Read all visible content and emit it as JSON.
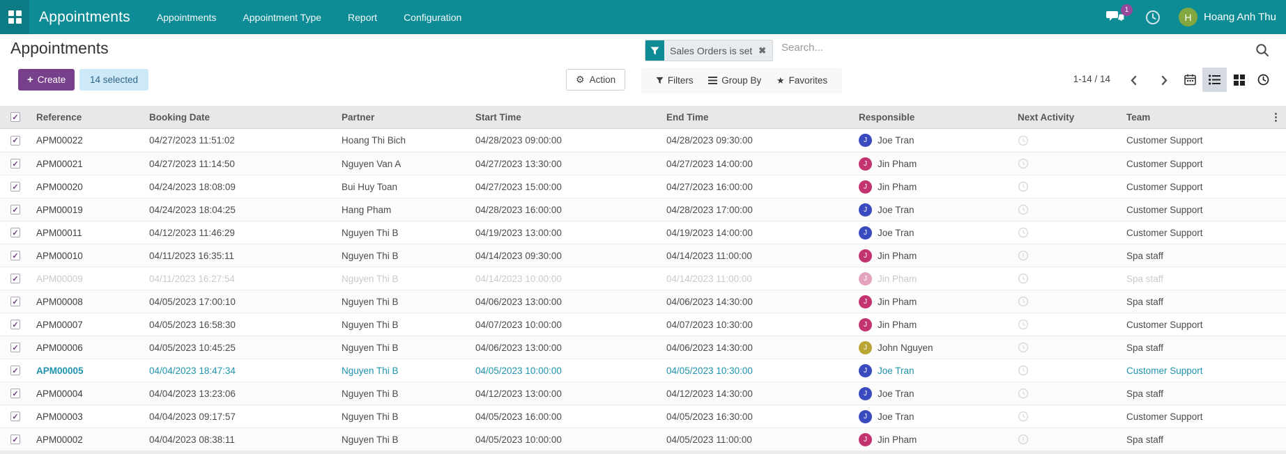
{
  "topbar": {
    "brand": "Appointments",
    "menus": [
      "Appointments",
      "Appointment Type",
      "Report",
      "Configuration"
    ],
    "messages_badge": "1",
    "user": {
      "initial": "H",
      "name": "Hoang Anh Thu"
    }
  },
  "control_panel": {
    "title": "Appointments",
    "create_label": "Create",
    "selected_label": "14 selected",
    "action_label": "Action",
    "filters_label": "Filters",
    "groupby_label": "Group By",
    "favorites_label": "Favorites",
    "pager": "1-14 / 14"
  },
  "search": {
    "facet_label": "Sales Orders is set",
    "placeholder": "Search..."
  },
  "icons": {
    "apps": "grid-2x2",
    "messages": "chat-bubbles",
    "activities": "clock",
    "facet": "funnel",
    "remove_facet": "x",
    "search": "magnifier",
    "action": "gear",
    "filters": "funnel",
    "group_by": "bars",
    "favorites": "star",
    "views": [
      "calendar",
      "list",
      "kanban",
      "activity-clock"
    ],
    "next_activity": "clock-outline",
    "column_options": "kebab-dots"
  },
  "colors": {
    "topbar": "#0e8c96",
    "create": "#76408a",
    "facet_accent": "#0e8c96",
    "highlight": "#1e93ae",
    "muted": "#c9c9c9"
  },
  "table": {
    "headers": [
      "Reference",
      "Booking Date",
      "Partner",
      "Start Time",
      "End Time",
      "Responsible",
      "Next Activity",
      "Team"
    ],
    "rows": [
      {
        "reference": "APM00022",
        "booking_date": "04/27/2023 11:51:02",
        "partner": "Hoang Thi Bich",
        "start_time": "04/28/2023 09:00:00",
        "end_time": "04/28/2023 09:30:00",
        "responsible": "Joe Tran",
        "avatar_initial": "J",
        "avatar_color": "#3a4bbf",
        "team": "Customer Support",
        "state": "normal"
      },
      {
        "reference": "APM00021",
        "booking_date": "04/27/2023 11:14:50",
        "partner": "Nguyen Van A",
        "start_time": "04/27/2023 13:30:00",
        "end_time": "04/27/2023 14:00:00",
        "responsible": "Jin Pham",
        "avatar_initial": "J",
        "avatar_color": "#c2336f",
        "team": "Customer Support",
        "state": "normal"
      },
      {
        "reference": "APM00020",
        "booking_date": "04/24/2023 18:08:09",
        "partner": "Bui Huy Toan",
        "start_time": "04/27/2023 15:00:00",
        "end_time": "04/27/2023 16:00:00",
        "responsible": "Jin Pham",
        "avatar_initial": "J",
        "avatar_color": "#c2336f",
        "team": "Customer Support",
        "state": "normal"
      },
      {
        "reference": "APM00019",
        "booking_date": "04/24/2023 18:04:25",
        "partner": "Hang Pham",
        "start_time": "04/28/2023 16:00:00",
        "end_time": "04/28/2023 17:00:00",
        "responsible": "Joe Tran",
        "avatar_initial": "J",
        "avatar_color": "#3a4bbf",
        "team": "Customer Support",
        "state": "normal"
      },
      {
        "reference": "APM00011",
        "booking_date": "04/12/2023 11:46:29",
        "partner": "Nguyen Thi B",
        "start_time": "04/19/2023 13:00:00",
        "end_time": "04/19/2023 14:00:00",
        "responsible": "Joe Tran",
        "avatar_initial": "J",
        "avatar_color": "#3a4bbf",
        "team": "Customer Support",
        "state": "normal"
      },
      {
        "reference": "APM00010",
        "booking_date": "04/11/2023 16:35:11",
        "partner": "Nguyen Thi B",
        "start_time": "04/14/2023 09:30:00",
        "end_time": "04/14/2023 11:00:00",
        "responsible": "Jin Pham",
        "avatar_initial": "J",
        "avatar_color": "#c2336f",
        "team": "Spa staff",
        "state": "normal"
      },
      {
        "reference": "APM00009",
        "booking_date": "04/11/2023 16:27:54",
        "partner": "Nguyen Thi B",
        "start_time": "04/14/2023 10:00:00",
        "end_time": "04/14/2023 11:00:00",
        "responsible": "Jin Pham",
        "avatar_initial": "J",
        "avatar_color": "#c2336f",
        "team": "Spa staff",
        "state": "muted"
      },
      {
        "reference": "APM00008",
        "booking_date": "04/05/2023 17:00:10",
        "partner": "Nguyen Thi B",
        "start_time": "04/06/2023 13:00:00",
        "end_time": "04/06/2023 14:30:00",
        "responsible": "Jin Pham",
        "avatar_initial": "J",
        "avatar_color": "#c2336f",
        "team": "Spa staff",
        "state": "normal"
      },
      {
        "reference": "APM00007",
        "booking_date": "04/05/2023 16:58:30",
        "partner": "Nguyen Thi B",
        "start_time": "04/07/2023 10:00:00",
        "end_time": "04/07/2023 10:30:00",
        "responsible": "Jin Pham",
        "avatar_initial": "J",
        "avatar_color": "#c2336f",
        "team": "Customer Support",
        "state": "normal"
      },
      {
        "reference": "APM00006",
        "booking_date": "04/05/2023 10:45:25",
        "partner": "Nguyen Thi B",
        "start_time": "04/06/2023 13:00:00",
        "end_time": "04/06/2023 14:30:00",
        "responsible": "John Nguyen",
        "avatar_initial": "J",
        "avatar_color": "#b8a533",
        "team": "Spa staff",
        "state": "normal"
      },
      {
        "reference": "APM00005",
        "booking_date": "04/04/2023 18:47:34",
        "partner": "Nguyen Thi B",
        "start_time": "04/05/2023 10:00:00",
        "end_time": "04/05/2023 10:30:00",
        "responsible": "Joe Tran",
        "avatar_initial": "J",
        "avatar_color": "#3a4bbf",
        "team": "Customer Support",
        "state": "highlight"
      },
      {
        "reference": "APM00004",
        "booking_date": "04/04/2023 13:23:06",
        "partner": "Nguyen Thi B",
        "start_time": "04/12/2023 13:00:00",
        "end_time": "04/12/2023 14:30:00",
        "responsible": "Joe Tran",
        "avatar_initial": "J",
        "avatar_color": "#3a4bbf",
        "team": "Spa staff",
        "state": "normal"
      },
      {
        "reference": "APM00003",
        "booking_date": "04/04/2023 09:17:57",
        "partner": "Nguyen Thi B",
        "start_time": "04/05/2023 16:00:00",
        "end_time": "04/05/2023 16:30:00",
        "responsible": "Joe Tran",
        "avatar_initial": "J",
        "avatar_color": "#3a4bbf",
        "team": "Customer Support",
        "state": "normal"
      },
      {
        "reference": "APM00002",
        "booking_date": "04/04/2023 08:38:11",
        "partner": "Nguyen Thi B",
        "start_time": "04/05/2023 10:00:00",
        "end_time": "04/05/2023 11:00:00",
        "responsible": "Jin Pham",
        "avatar_initial": "J",
        "avatar_color": "#c2336f",
        "team": "Spa staff",
        "state": "normal"
      }
    ]
  }
}
